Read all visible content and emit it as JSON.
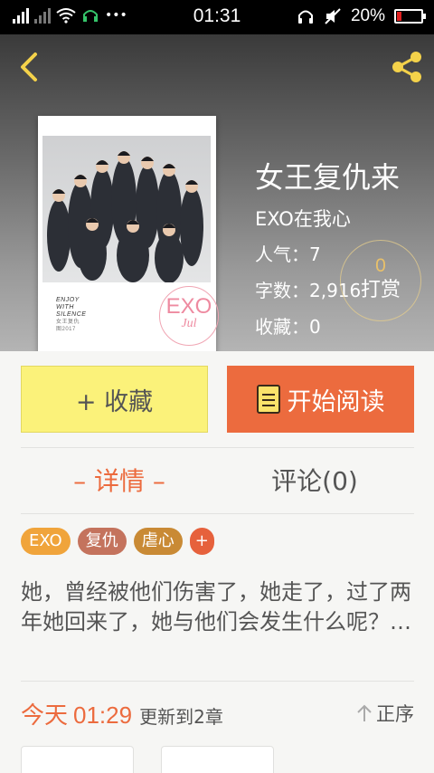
{
  "status_bar": {
    "time": "01:31",
    "battery": "20%",
    "battery_level": 0.2,
    "icons": [
      "signal-icon",
      "signal-2-icon",
      "wifi-icon",
      "headset-icon",
      "more-icon",
      "headphones-icon",
      "mute-icon",
      "battery-icon"
    ]
  },
  "header": {
    "back_icon": "chevron-left-icon",
    "share_icon": "share-icon"
  },
  "book": {
    "title": "女王复仇来",
    "author": "EXO在我心",
    "popularity": "人气：7",
    "word_count": "字数：2,916",
    "favorites": "收藏：0",
    "cover": {
      "line1": "ENJOY",
      "line2": "WITH",
      "line3": "SILENCE",
      "line4": "女王复仇",
      "line5": "图2017",
      "stamp_big": "EXO",
      "stamp_small": "Jul"
    }
  },
  "tip": {
    "count": "0",
    "label": "打赏"
  },
  "actions": {
    "favorite_label": "+ 收藏",
    "read_label": "开始阅读"
  },
  "tabs": [
    {
      "label": "– 详情 –",
      "active": true
    },
    {
      "label": "评论(0)",
      "active": false
    }
  ],
  "tags": [
    {
      "label": "EXO",
      "color": "#f0a43b"
    },
    {
      "label": "复仇",
      "color": "#c4735d"
    },
    {
      "label": "虐心",
      "color": "#c98a35"
    }
  ],
  "tag_add": "+",
  "description": "她，曾经被他们伤害了，她走了，过了两年她回来了，她与他们会发生什么呢？…",
  "update": {
    "date": "今天",
    "time": "01:29",
    "info": "更新到2章"
  },
  "sort_label": "正序",
  "colors": {
    "accent": "#ec6b3e",
    "favorite_bg": "#fbf27a",
    "tip_gold": "#e8c06a"
  }
}
